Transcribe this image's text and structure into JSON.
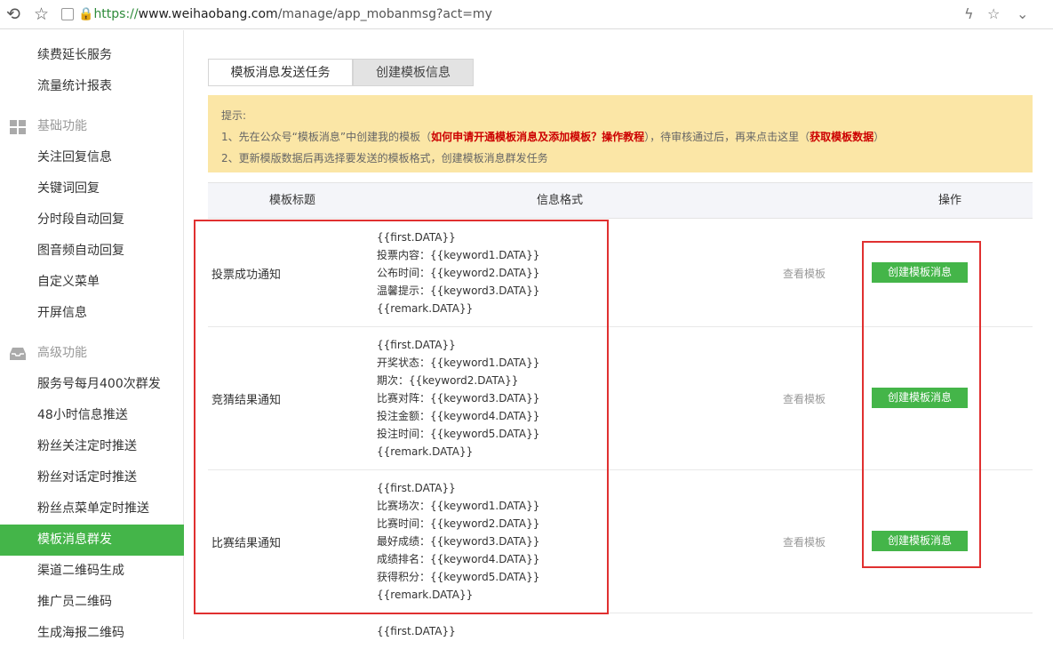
{
  "browser": {
    "url_scheme": "https://",
    "url_host": "www.weihaobang.com",
    "url_path": "/manage/app_mobanmsg?act=my"
  },
  "sidebar": {
    "items_top": [
      "续费延长服务",
      "流量统计报表"
    ],
    "cat_basic": "基础功能",
    "items_basic": [
      "关注回复信息",
      "关键词回复",
      "分时段自动回复",
      "图音频自动回复",
      "自定义菜单",
      "开屏信息"
    ],
    "cat_advanced": "高级功能",
    "items_advanced": [
      "服务号每月400次群发",
      "48小时信息推送",
      "粉丝关注定时推送",
      "粉丝对话定时推送",
      "粉丝点菜单定时推送",
      "模板消息群发",
      "渠道二维码生成",
      "推广员二维码",
      "生成海报二维码"
    ],
    "active_item": "模板消息群发"
  },
  "tabs": [
    "模板消息发送任务",
    "创建模板信息"
  ],
  "tip": {
    "title": "提示:",
    "line1_a": "1、先在公众号“模板消息”中创建我的模板（",
    "line1_link1": "如何申请开通模板消息及添加模板？操作教程",
    "line1_b": "），待审核通过后，再来点击这里（",
    "line1_link2": "获取模板数据",
    "line1_c": "）",
    "line2": "2、更新模版数据后再选择要发送的模板格式，创建模板消息群发任务"
  },
  "table": {
    "headers": [
      "模板标题",
      "信息格式",
      "操作"
    ],
    "rows": [
      {
        "title": "投票成功通知",
        "format": [
          "{{first.DATA}}",
          "投票内容：{{keyword1.DATA}}",
          "公布时间：{{keyword2.DATA}}",
          "温馨提示：{{keyword3.DATA}}",
          "{{remark.DATA}}"
        ],
        "view": "查看模板",
        "action": "创建模板消息"
      },
      {
        "title": "竞猜结果通知",
        "format": [
          "{{first.DATA}}",
          "开奖状态：{{keyword1.DATA}}",
          "期次：{{keyword2.DATA}}",
          "比赛对阵：{{keyword3.DATA}}",
          "投注金额：{{keyword4.DATA}}",
          "投注时间：{{keyword5.DATA}}",
          "{{remark.DATA}}"
        ],
        "view": "查看模板",
        "action": "创建模板消息"
      },
      {
        "title": "比赛结果通知",
        "format": [
          "{{first.DATA}}",
          "比赛场次：{{keyword1.DATA}}",
          "比赛时间：{{keyword2.DATA}}",
          "最好成绩：{{keyword3.DATA}}",
          "成绩排名：{{keyword4.DATA}}",
          "获得积分：{{keyword5.DATA}}",
          "{{remark.DATA}}"
        ],
        "view": "查看模板",
        "action": "创建模板消息"
      },
      {
        "title": "",
        "format": [
          "{{first.DATA}}"
        ],
        "view": "",
        "action": ""
      }
    ]
  },
  "colors": {
    "accent_green": "#44b549",
    "tip_bg": "#fbe6a6",
    "highlight_red": "#e03030",
    "link_red": "#cc0000"
  }
}
